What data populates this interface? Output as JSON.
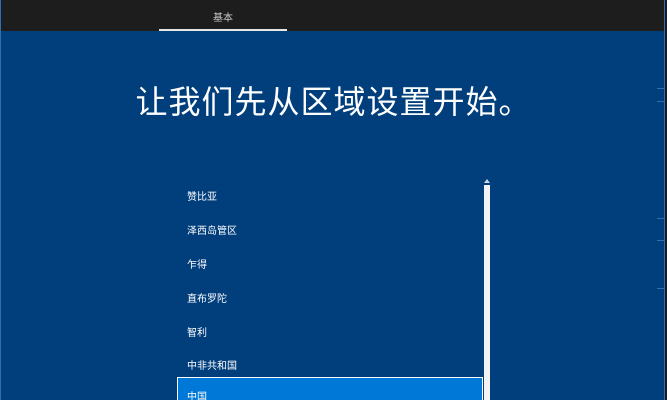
{
  "header": {
    "tab_label": "基本"
  },
  "main": {
    "title": "让我们先从区域设置开始。",
    "regions": [
      {
        "label": "赞比亚",
        "selected": false
      },
      {
        "label": "泽西岛管区",
        "selected": false
      },
      {
        "label": "乍得",
        "selected": false
      },
      {
        "label": "直布罗陀",
        "selected": false
      },
      {
        "label": "智利",
        "selected": false
      },
      {
        "label": "中非共和国",
        "selected": false
      },
      {
        "label": "中国",
        "selected": true
      }
    ]
  },
  "colors": {
    "background": "#003e7c",
    "topbar": "#1d1d1d",
    "selected": "#0078d7"
  }
}
